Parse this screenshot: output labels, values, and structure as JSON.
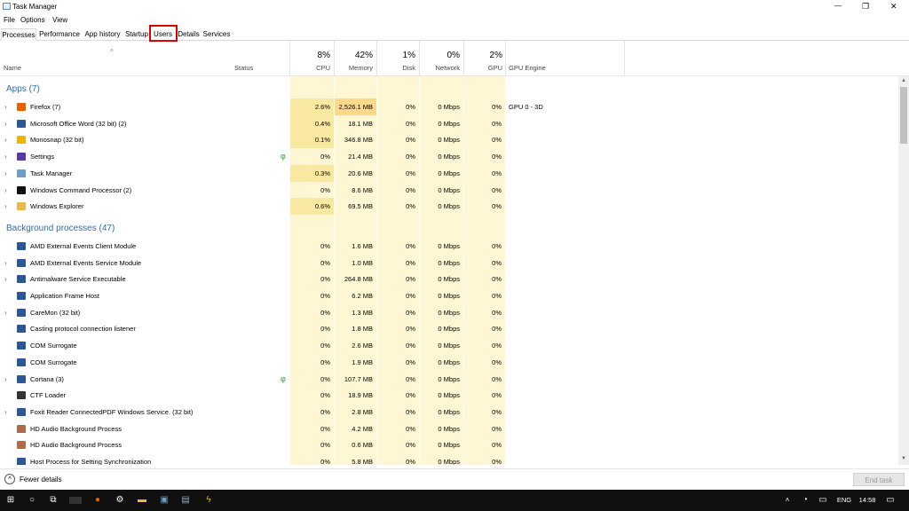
{
  "window": {
    "title": "Task Manager",
    "min": "—",
    "max": "❐",
    "close": "✕"
  },
  "menu": [
    "File",
    "Options",
    "View"
  ],
  "tabs": [
    "Processes",
    "Performance",
    "App history",
    "Startup",
    "Users",
    "Details",
    "Services"
  ],
  "columns": {
    "sort_arrow": "^",
    "name": "Name",
    "status": "Status",
    "cpu": {
      "pct": "8%",
      "label": "CPU"
    },
    "memory": {
      "pct": "42%",
      "label": "Memory"
    },
    "disk": {
      "pct": "1%",
      "label": "Disk"
    },
    "network": {
      "pct": "0%",
      "label": "Network"
    },
    "gpu": {
      "pct": "2%",
      "label": "GPU"
    },
    "gpu_engine": "GPU Engine"
  },
  "groups": {
    "apps": "Apps (7)",
    "background": "Background processes (47)"
  },
  "apps": [
    {
      "name": "Firefox (7)",
      "exp": "›",
      "cpu": "2.6%",
      "mem": "2,526.1 MB",
      "disk": "0%",
      "net": "0 Mbps",
      "gpu": "0%",
      "eng": "GPU 0 - 3D",
      "icon": "#e66000",
      "leaf": ""
    },
    {
      "name": "Microsoft Office Word (32 bit) (2)",
      "exp": "›",
      "cpu": "0.4%",
      "mem": "18.1 MB",
      "disk": "0%",
      "net": "0 Mbps",
      "gpu": "0%",
      "eng": "",
      "icon": "#2b5797",
      "leaf": ""
    },
    {
      "name": "Monosnap (32 bit)",
      "exp": "›",
      "cpu": "0.1%",
      "mem": "346.8 MB",
      "disk": "0%",
      "net": "0 Mbps",
      "gpu": "0%",
      "eng": "",
      "icon": "#f0b400",
      "leaf": ""
    },
    {
      "name": "Settings",
      "exp": "›",
      "cpu": "0%",
      "mem": "21.4 MB",
      "disk": "0%",
      "net": "0 Mbps",
      "gpu": "0%",
      "eng": "",
      "icon": "#5a3aa0",
      "leaf": "φ"
    },
    {
      "name": "Task Manager",
      "exp": "›",
      "cpu": "0.3%",
      "mem": "20.6 MB",
      "disk": "0%",
      "net": "0 Mbps",
      "gpu": "0%",
      "eng": "",
      "icon": "#6aa0c8",
      "leaf": ""
    },
    {
      "name": "Windows Command Processor (2)",
      "exp": "›",
      "cpu": "0%",
      "mem": "8.6 MB",
      "disk": "0%",
      "net": "0 Mbps",
      "gpu": "0%",
      "eng": "",
      "icon": "#111111",
      "leaf": ""
    },
    {
      "name": "Windows Explorer",
      "exp": "›",
      "cpu": "0.6%",
      "mem": "69.5 MB",
      "disk": "0%",
      "net": "0 Mbps",
      "gpu": "0%",
      "eng": "",
      "icon": "#e8b84a",
      "leaf": ""
    }
  ],
  "background": [
    {
      "name": "AMD External Events Client Module",
      "exp": "",
      "cpu": "0%",
      "mem": "1.6 MB",
      "disk": "0%",
      "net": "0 Mbps",
      "gpu": "0%",
      "icon": "#2b5797",
      "leaf": ""
    },
    {
      "name": "AMD External Events Service Module",
      "exp": "›",
      "cpu": "0%",
      "mem": "1.0 MB",
      "disk": "0%",
      "net": "0 Mbps",
      "gpu": "0%",
      "icon": "#2b5797",
      "leaf": ""
    },
    {
      "name": "Antimalware Service Executable",
      "exp": "›",
      "cpu": "0%",
      "mem": "264.8 MB",
      "disk": "0%",
      "net": "0 Mbps",
      "gpu": "0%",
      "icon": "#2b5797",
      "leaf": ""
    },
    {
      "name": "Application Frame Host",
      "exp": "",
      "cpu": "0%",
      "mem": "6.2 MB",
      "disk": "0%",
      "net": "0 Mbps",
      "gpu": "0%",
      "icon": "#2b5797",
      "leaf": ""
    },
    {
      "name": "CareMon (32 bit)",
      "exp": "›",
      "cpu": "0%",
      "mem": "1.3 MB",
      "disk": "0%",
      "net": "0 Mbps",
      "gpu": "0%",
      "icon": "#2b5797",
      "leaf": ""
    },
    {
      "name": "Casting protocol connection listener",
      "exp": "",
      "cpu": "0%",
      "mem": "1.8 MB",
      "disk": "0%",
      "net": "0 Mbps",
      "gpu": "0%",
      "icon": "#2b5797",
      "leaf": ""
    },
    {
      "name": "COM Surrogate",
      "exp": "",
      "cpu": "0%",
      "mem": "2.6 MB",
      "disk": "0%",
      "net": "0 Mbps",
      "gpu": "0%",
      "icon": "#2b5797",
      "leaf": ""
    },
    {
      "name": "COM Surrogate",
      "exp": "",
      "cpu": "0%",
      "mem": "1.9 MB",
      "disk": "0%",
      "net": "0 Mbps",
      "gpu": "0%",
      "icon": "#2b5797",
      "leaf": ""
    },
    {
      "name": "Cortana (3)",
      "exp": "›",
      "cpu": "0%",
      "mem": "107.7 MB",
      "disk": "0%",
      "net": "0 Mbps",
      "gpu": "0%",
      "icon": "#2b5797",
      "leaf": "φ"
    },
    {
      "name": "CTF Loader",
      "exp": "",
      "cpu": "0%",
      "mem": "18.9 MB",
      "disk": "0%",
      "net": "0 Mbps",
      "gpu": "0%",
      "icon": "#333333",
      "leaf": ""
    },
    {
      "name": "Foxit Reader ConnectedPDF Windows Service. (32 bit)",
      "exp": "›",
      "cpu": "0%",
      "mem": "2.8 MB",
      "disk": "0%",
      "net": "0 Mbps",
      "gpu": "0%",
      "icon": "#2b5797",
      "leaf": ""
    },
    {
      "name": "HD Audio Background Process",
      "exp": "",
      "cpu": "0%",
      "mem": "4.2 MB",
      "disk": "0%",
      "net": "0 Mbps",
      "gpu": "0%",
      "icon": "#b06a4a",
      "leaf": ""
    },
    {
      "name": "HD Audio Background Process",
      "exp": "",
      "cpu": "0%",
      "mem": "0.6 MB",
      "disk": "0%",
      "net": "0 Mbps",
      "gpu": "0%",
      "icon": "#b06a4a",
      "leaf": ""
    },
    {
      "name": "Host Process for Setting Synchronization",
      "exp": "",
      "cpu": "0%",
      "mem": "5.8 MB",
      "disk": "0%",
      "net": "0 Mbps",
      "gpu": "0%",
      "icon": "#2b5797",
      "leaf": ""
    }
  ],
  "footer": {
    "fewer": "Fewer details",
    "end_task": "End task"
  },
  "taskbar": {
    "lang": "ENG",
    "time": "14:58"
  },
  "colors": {
    "cpu_hi": "#f9e8a0",
    "mem_hi": "#fcd88a",
    "cell": "#fff4c4",
    "group_text": "#2a6fb4",
    "highlight": "#e00000"
  }
}
